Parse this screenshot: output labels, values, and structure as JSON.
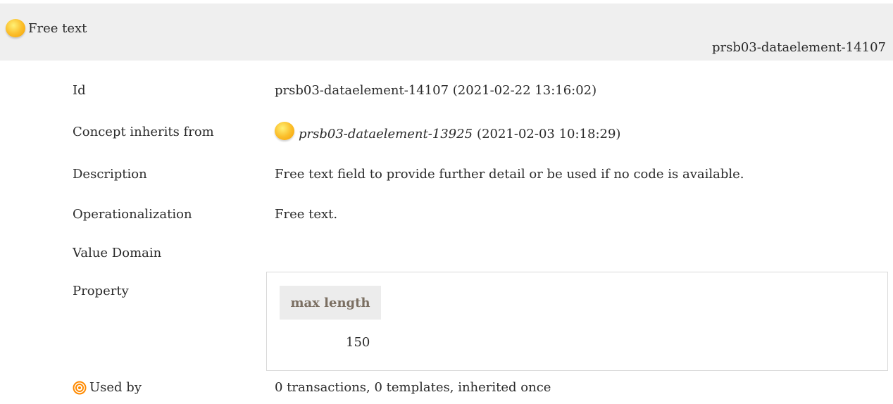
{
  "header": {
    "title": "Free text",
    "element_id": "prsb03-dataelement-14107",
    "status_icon": "yellow-dot-icon"
  },
  "details": {
    "id_label": "Id",
    "id_value": "prsb03-dataelement-14107 (2021-02-22 13:16:02)",
    "inherits_label": "Concept inherits from",
    "inherits_link": "prsb03-dataelement-13925",
    "inherits_date": "(2021-02-03 10:18:29)",
    "description_label": "Description",
    "description_value": "Free text field to provide further detail or be used if no code is available.",
    "operationalization_label": "Operationalization",
    "operationalization_value": "Free text.",
    "value_domain_label": "Value Domain",
    "property_label": "Property"
  },
  "property_table": {
    "column_header": "max length",
    "value": "150"
  },
  "used_by": {
    "label": "Used by",
    "value": "0 transactions, 0 templates, inherited once",
    "icon": "target-icon"
  },
  "colors": {
    "header_background": "#efefef",
    "yellow_status": "#fbc02d",
    "property_header_text": "#7b6f62",
    "used_by_icon": "#ff8a00"
  }
}
